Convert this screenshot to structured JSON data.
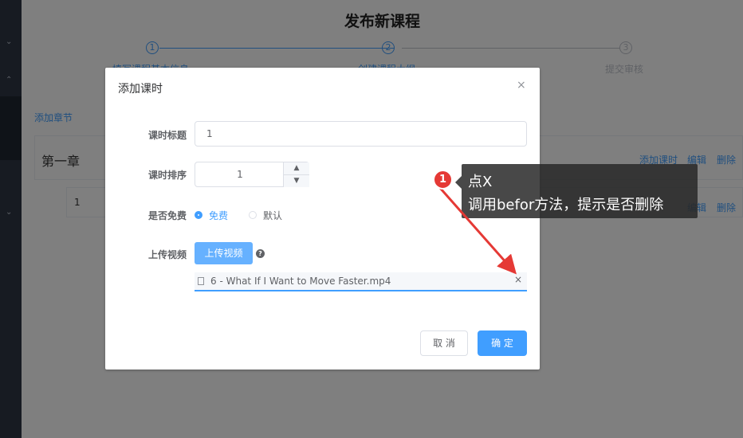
{
  "page": {
    "title": "发布新课程",
    "steps": [
      {
        "number": "1",
        "label": "填写课程基本信息"
      },
      {
        "number": "2",
        "label": "创建课程大纲"
      },
      {
        "number": "3",
        "label": "提交审核"
      }
    ]
  },
  "chapter_area": {
    "add_chapter": "添加章节",
    "chapter_title": "第一章",
    "chapter_actions": [
      "添加课时",
      "编辑",
      "删除"
    ],
    "lesson_title": "1",
    "lesson_actions": [
      "编辑",
      "删除"
    ]
  },
  "dialog": {
    "title": "添加课时",
    "close_icon": "×",
    "fields": {
      "title_label": "课时标题",
      "title_value": "1",
      "sort_label": "课时排序",
      "sort_value": "1",
      "free_label": "是否免费",
      "free_options": [
        "免费",
        "默认"
      ],
      "upload_label": "上传视频",
      "upload_button": "上传视频",
      "help_icon": "?",
      "file_name": "6 - What If I Want to Move Faster.mp4",
      "file_remove": "×"
    },
    "buttons": {
      "cancel": "取 消",
      "confirm": "确 定"
    }
  },
  "annotation": {
    "marker": "1",
    "line1": "点X",
    "line2": "调用befor方法，提示是否删除"
  },
  "colors": {
    "primary": "#409eff",
    "sidebar": "#2f3644",
    "annotation_red": "#e53935"
  }
}
